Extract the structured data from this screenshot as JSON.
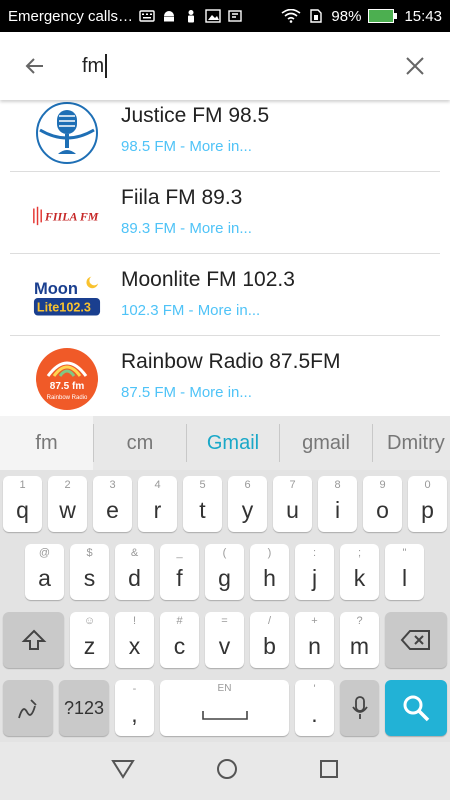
{
  "status_bar": {
    "carrier": "Emergency calls…",
    "battery": "98%",
    "time": "15:43"
  },
  "search": {
    "query": "fm"
  },
  "results": [
    {
      "title": "Justice FM 98.5",
      "subtitle": "98.5 FM - More in..."
    },
    {
      "title": "Fiila FM 89.3",
      "subtitle": "89.3 FM - More in..."
    },
    {
      "title": "Moonlite FM 102.3",
      "subtitle": "102.3 FM - More in..."
    },
    {
      "title": "Rainbow Radio 87.5FM",
      "subtitle": "87.5 FM - More in..."
    }
  ],
  "logos": {
    "fiila_text": "FIILA FM",
    "moonlite_top": "Moon",
    "moonlite_bottom": "Lite102.3",
    "rainbow_freq": "87.5 fm",
    "rainbow_name": "Rainbow Radio"
  },
  "suggestions": [
    "fm",
    "cm",
    "Gmail",
    "gmail",
    "Dmitry"
  ],
  "keyboard": {
    "row1": [
      {
        "hint": "1",
        "key": "q"
      },
      {
        "hint": "2",
        "key": "w"
      },
      {
        "hint": "3",
        "key": "e"
      },
      {
        "hint": "4",
        "key": "r"
      },
      {
        "hint": "5",
        "key": "t"
      },
      {
        "hint": "6",
        "key": "y"
      },
      {
        "hint": "7",
        "key": "u"
      },
      {
        "hint": "8",
        "key": "i"
      },
      {
        "hint": "9",
        "key": "o"
      },
      {
        "hint": "0",
        "key": "p"
      }
    ],
    "row2": [
      {
        "hint": "@",
        "key": "a"
      },
      {
        "hint": "$",
        "key": "s"
      },
      {
        "hint": "&",
        "key": "d"
      },
      {
        "hint": "_",
        "key": "f"
      },
      {
        "hint": "(",
        "key": "g"
      },
      {
        "hint": ")",
        "key": "h"
      },
      {
        "hint": ":",
        "key": "j"
      },
      {
        "hint": ";",
        "key": "k"
      },
      {
        "hint": "\"",
        "key": "l"
      }
    ],
    "row3": [
      {
        "hint": "☺",
        "key": "z"
      },
      {
        "hint": "!",
        "key": "x"
      },
      {
        "hint": "#",
        "key": "c"
      },
      {
        "hint": "=",
        "key": "v"
      },
      {
        "hint": "/",
        "key": "b"
      },
      {
        "hint": "+",
        "key": "n"
      },
      {
        "hint": "?",
        "key": "m"
      }
    ],
    "symbols_label": "?123",
    "comma": ",",
    "comma_hint": "-",
    "space_hint": "EN",
    "period": ".",
    "period_hint": "'"
  },
  "colors": {
    "accent": "#1aa8c8",
    "subtitle": "#4fc3f7",
    "search_key": "#22b2d6"
  }
}
